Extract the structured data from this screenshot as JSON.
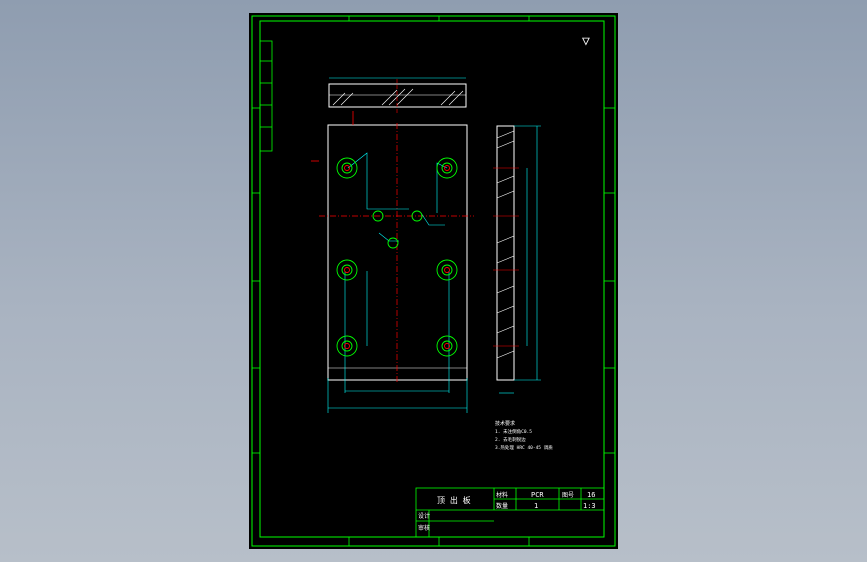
{
  "colors": {
    "background": "#000000",
    "border": "#00ff00",
    "outline": "#ffffff",
    "dimension": "#00ffff",
    "centerline": "#ff0000",
    "circles": "#00ff00",
    "hatch": "#ffffff",
    "text": "#ffffff",
    "annotation_yellow": "#ffff00"
  },
  "drawing": {
    "roughness_symbol": "▽",
    "notes_title": "技术要求",
    "notes": [
      "1. 未注倒角C0.5",
      "2. 去毛刺锐边",
      "3.热处理 HRC 40-45  调质"
    ]
  },
  "title_block": {
    "part_name": "顶 出 板",
    "material_label": "材料",
    "material_value": "PCR",
    "quantity_label": "数量",
    "quantity_value": "1",
    "drawing_no_label": "图号",
    "drawing_no_value": "16",
    "scale_value": "1:3",
    "designer_label": "设计",
    "checker_label": "审核"
  }
}
